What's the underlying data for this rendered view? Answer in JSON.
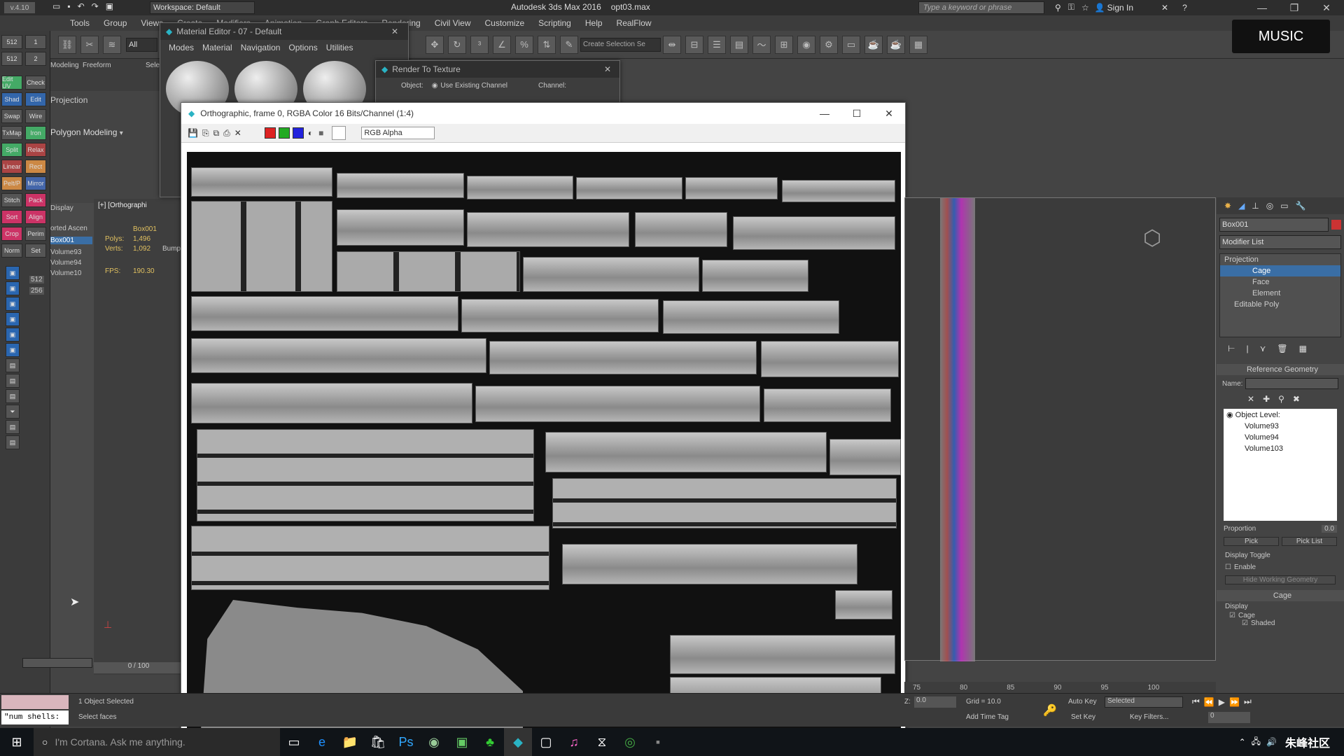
{
  "app": {
    "version_badge": "v.4.10",
    "workspace_label": "Workspace: Default",
    "title": "Autodesk 3ds Max 2016",
    "filename": "opt03.max",
    "search_placeholder": "Type a keyword or phrase",
    "sign_in": "Sign In",
    "music_label": "MUSIC"
  },
  "menubar": [
    "Tools",
    "Group",
    "Views",
    "Create",
    "Modifiers",
    "Animation",
    "Graph Editors",
    "Rendering",
    "Civil View",
    "Customize",
    "Scripting",
    "Help",
    "RealFlow"
  ],
  "toolbar": {
    "selection_set": "Create Selection Se",
    "filter": "All"
  },
  "left_strip": {
    "rows": [
      [
        "512",
        "1"
      ],
      [
        "512",
        "2"
      ]
    ],
    "labels": [
      "Edit UV",
      "Check",
      "Shad",
      "Edit",
      "Swap",
      "Wire",
      "TxMap",
      "Iron",
      "Split",
      "Relax",
      "Linear",
      "Rect",
      "Pelt/P",
      "Mirror",
      "Stitch",
      "Pack",
      "Sort",
      "Align",
      "Crop",
      "Perim",
      "Norm",
      "Set"
    ]
  },
  "ribbon": {
    "tabs": [
      "Modeling",
      "Freeform",
      "Selection"
    ],
    "projection": "Projection",
    "polygon_modeling": "Polygon Modeling"
  },
  "scene_explorer": {
    "header": "Display",
    "sort_label": "orted Ascen",
    "items": [
      "Box001",
      "Volume93",
      "Volume94",
      "Volume10"
    ],
    "numbers": [
      "512",
      "256"
    ]
  },
  "viewport_left": {
    "label": "[+] [Orthographi",
    "stats": {
      "object": "Box001",
      "polys_label": "Polys:",
      "polys": "1,496",
      "verts_label": "Verts:",
      "verts": "1,092",
      "fps_label": "FPS:",
      "fps": "190.30"
    },
    "timeline": "0 / 100"
  },
  "material_editor": {
    "title": "Material Editor - 07 - Default",
    "menus": [
      "Modes",
      "Material",
      "Navigation",
      "Options",
      "Utilities"
    ]
  },
  "rtt": {
    "title": "Render To Texture",
    "object_label": "Object:",
    "option": "Use Existing Channel",
    "channel_label": "Channel:",
    "bump": "Bump"
  },
  "frame_window": {
    "title": "Orthographic, frame 0, RGBA Color 16 Bits/Channel (1:4)",
    "channel_select": "RGB Alpha"
  },
  "command_panel": {
    "object_name": "Box001",
    "modifier_list": "Modifier List",
    "stack": [
      "Projection",
      "Cage",
      "Face",
      "Element",
      "Editable Poly"
    ],
    "rollout_ref": "Reference Geometry",
    "name_label": "Name:",
    "object_level": "Object Level:",
    "volumes": [
      "Volume93",
      "Volume94",
      "Volume103"
    ],
    "proportion_label": "Proportion",
    "proportion_value": "0.0",
    "pick": "Pick",
    "pick_list": "Pick List",
    "display_toggle": "Display Toggle",
    "enable": "Enable",
    "hide_geom": "Hide Working Geometry",
    "cage_rollout": "Cage",
    "display": "Display",
    "cage": "Cage",
    "shaded": "Shaded"
  },
  "timeline_ticks": [
    "75",
    "80",
    "85",
    "90",
    "95",
    "100"
  ],
  "status": {
    "maxscript": "\"num shells:",
    "selected": "1 Object Selected",
    "prompt": "Select faces",
    "z_label": "Z:",
    "z_value": "0.0",
    "grid": "Grid = 10.0",
    "add_time_tag": "Add Time Tag",
    "auto_key": "Auto Key",
    "set_key": "Set Key",
    "selected_dropdown": "Selected",
    "key_filters": "Key Filters...",
    "frame": "0"
  },
  "taskbar": {
    "cortana": "I'm Cortana. Ask me anything.",
    "watermark": "朱峰社区"
  }
}
